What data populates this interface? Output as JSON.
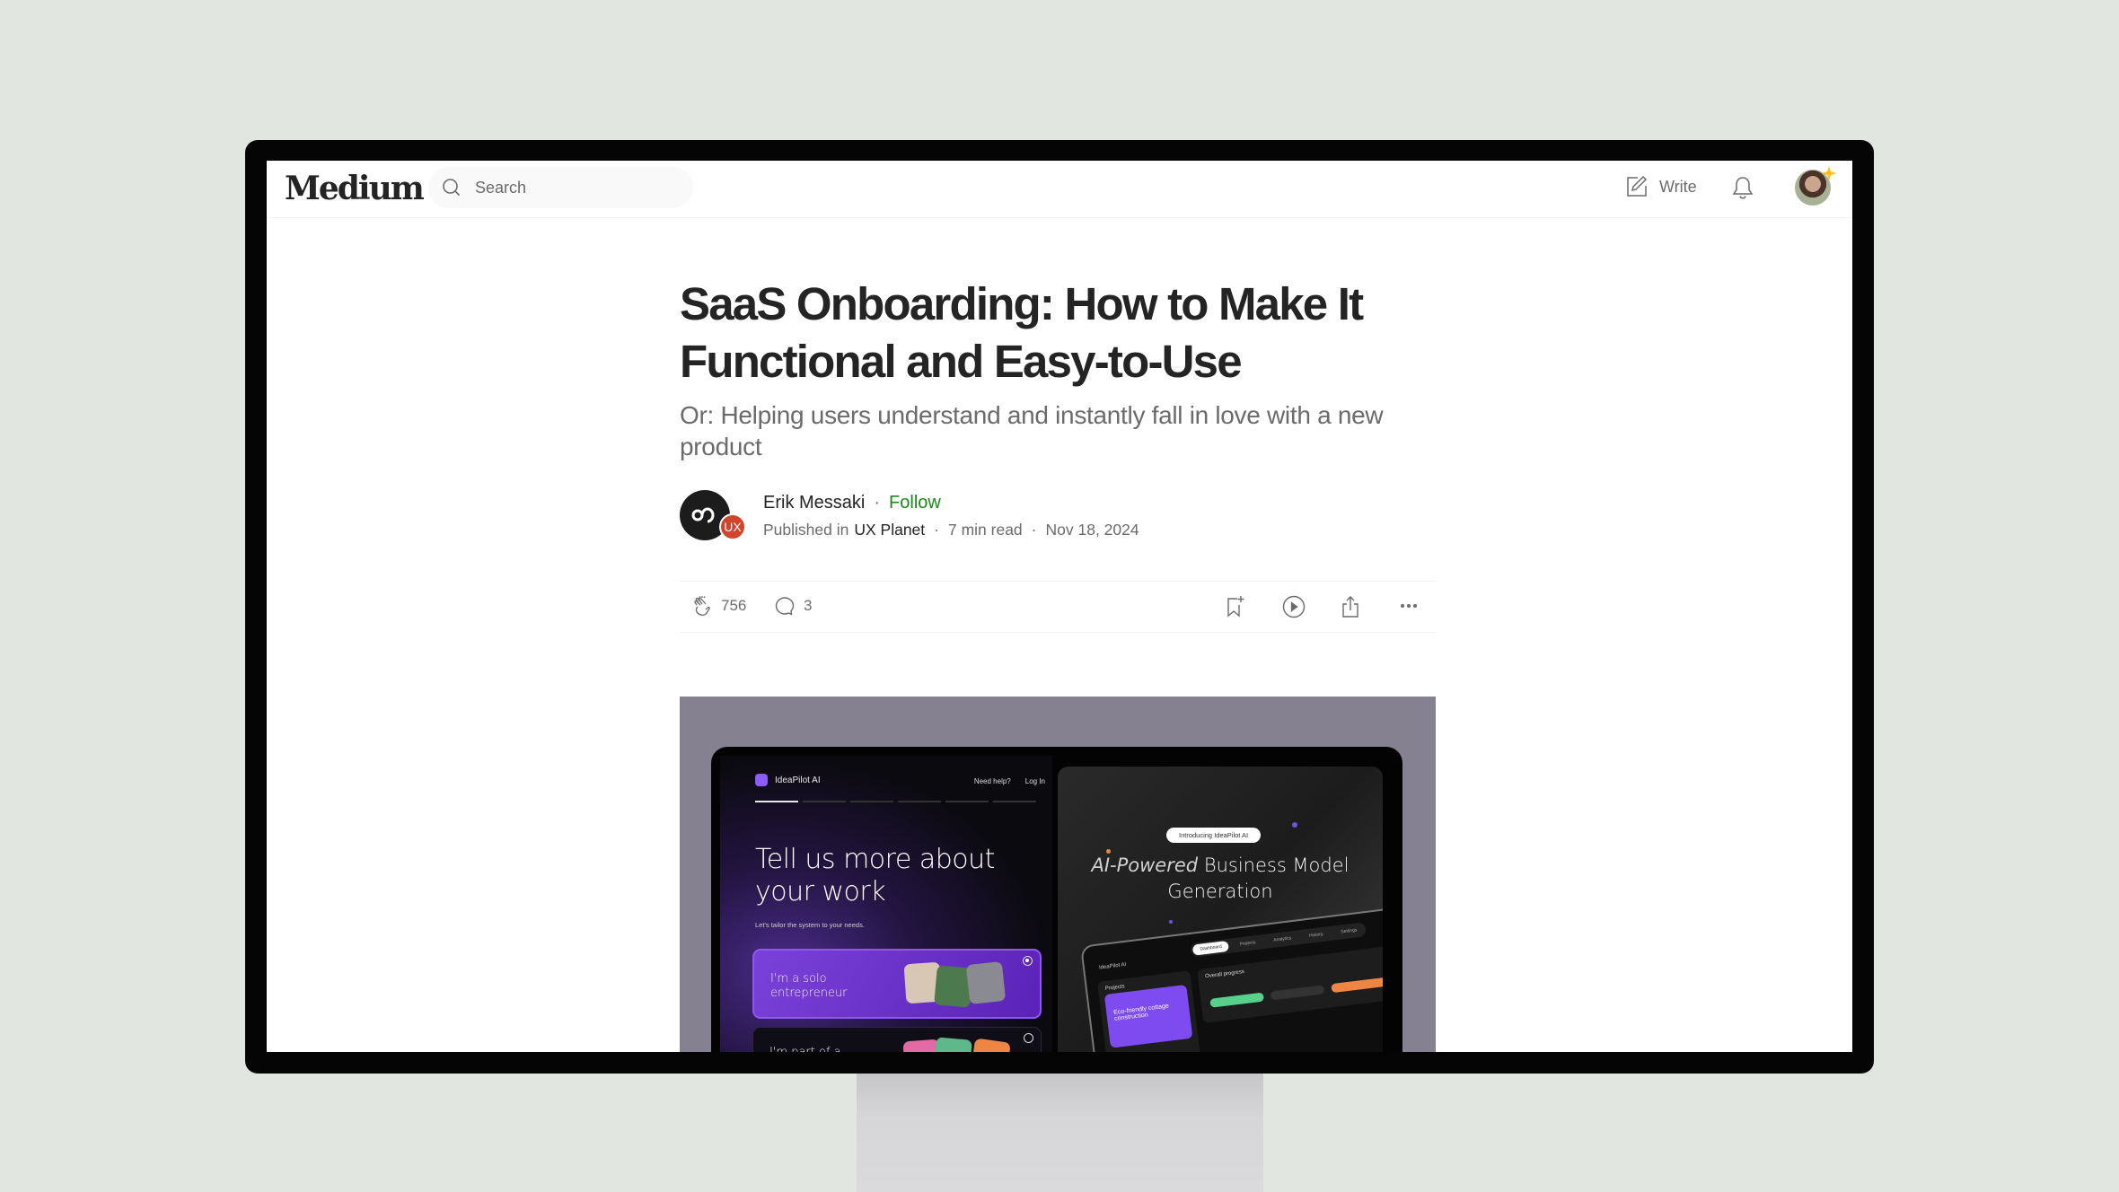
{
  "nav": {
    "logo": "Medium",
    "search_placeholder": "Search",
    "write_label": "Write"
  },
  "article": {
    "title": "SaaS Onboarding: How to Make It Functional and Easy-to-Use",
    "subtitle": "Or: Helping users understand and instantly fall in love with a new product",
    "author": "Erik Messaki",
    "follow_label": "Follow",
    "separator": "·",
    "published_in_prefix": "Published in",
    "publication": "UX Planet",
    "publication_badge": "UX",
    "read_time": "7 min read",
    "date": "Nov 18, 2024",
    "claps": "756",
    "comments": "3"
  },
  "hero_image": {
    "left_panel": {
      "brand": "IdeaPilot AI",
      "links": [
        "Need help?",
        "Log In"
      ],
      "heading": "Tell us more about your work",
      "subheading": "Let's tailor the system to your needs.",
      "options": [
        "I'm a solo entrepreneur",
        "I'm part of a"
      ]
    },
    "right_panel": {
      "pill": "Introducing IdeaPilot AI",
      "heading_italic": "AI-Powered",
      "heading_rest": "Business Model Generation",
      "dashboard_tabs": [
        "Dashboard",
        "Projects",
        "Analytics",
        "History",
        "Settings"
      ],
      "dashboard_brand": "IdeaPilot AI",
      "projects_label": "Projects",
      "project_card": "Eco-friendly cottage construction",
      "overall_progress": "Overall progress"
    }
  },
  "colors": {
    "follow_green": "#1a8917",
    "text_primary": "#242424",
    "text_secondary": "#6b6b6b",
    "publication_red": "#d2452c",
    "hero_bg": "#858190",
    "accent_purple": "#7d4bf0"
  }
}
